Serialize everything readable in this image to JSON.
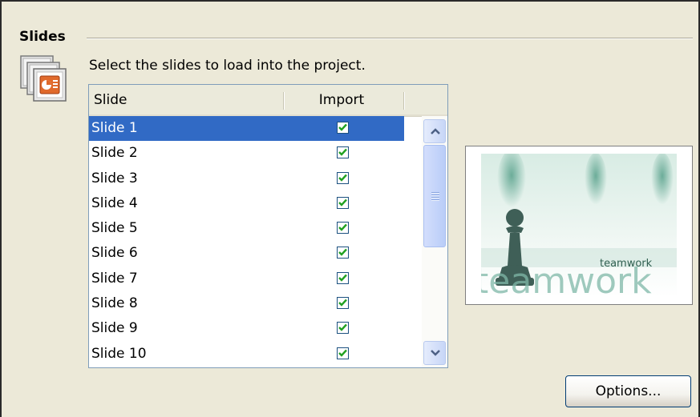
{
  "group": {
    "title": "Slides"
  },
  "instruction": "Select the slides to load into the project.",
  "table": {
    "headers": {
      "slide": "Slide",
      "import": "Import"
    },
    "rows": [
      {
        "label": "Slide 1",
        "import": true,
        "selected": true
      },
      {
        "label": "Slide 2",
        "import": true
      },
      {
        "label": "Slide 3",
        "import": true
      },
      {
        "label": "Slide 4",
        "import": true
      },
      {
        "label": "Slide 5",
        "import": true
      },
      {
        "label": "Slide 6",
        "import": true
      },
      {
        "label": "Slide 7",
        "import": true
      },
      {
        "label": "Slide 8",
        "import": true
      },
      {
        "label": "Slide 9",
        "import": true
      },
      {
        "label": "Slide 10",
        "import": true
      }
    ]
  },
  "preview": {
    "title": "teamwork",
    "subtitle": "teamwork"
  },
  "buttons": {
    "options": "Options..."
  },
  "icons": {
    "group": "powerpoint-slides-icon",
    "check": "checkmark-icon",
    "scroll_up": "chevron-up-icon",
    "scroll_down": "chevron-down-icon"
  },
  "colors": {
    "selection": "#316ac5",
    "check": "#21a121",
    "background": "#ece9d8",
    "border": "#7f9db9"
  }
}
